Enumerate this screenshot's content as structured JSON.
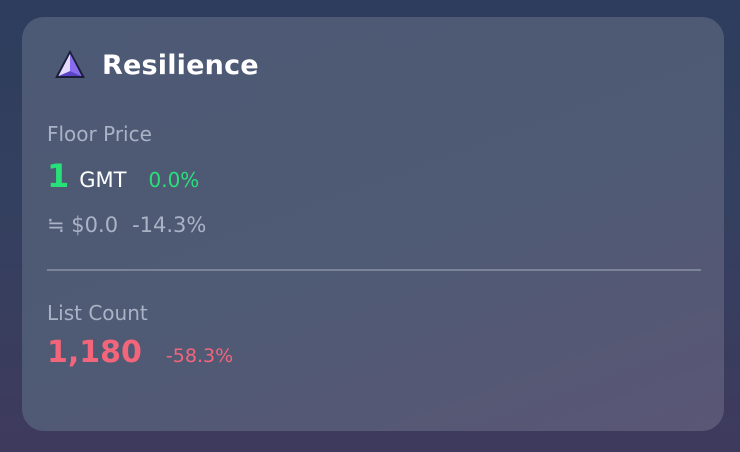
{
  "card": {
    "title": "Resilience",
    "logo_icon": "triangle-prism-icon",
    "floor_price": {
      "label": "Floor Price",
      "value": "1",
      "unit": "GMT",
      "change": "0.0%",
      "usd_value": "≒ $0.0",
      "usd_change": "-14.3%"
    },
    "list_count": {
      "label": "List Count",
      "value": "1,180",
      "change": "-58.3%"
    }
  },
  "colors": {
    "positive": "#28e07a",
    "negative": "#f3657a",
    "muted": "#aab3c6",
    "card_bg": "#4f5a74"
  }
}
